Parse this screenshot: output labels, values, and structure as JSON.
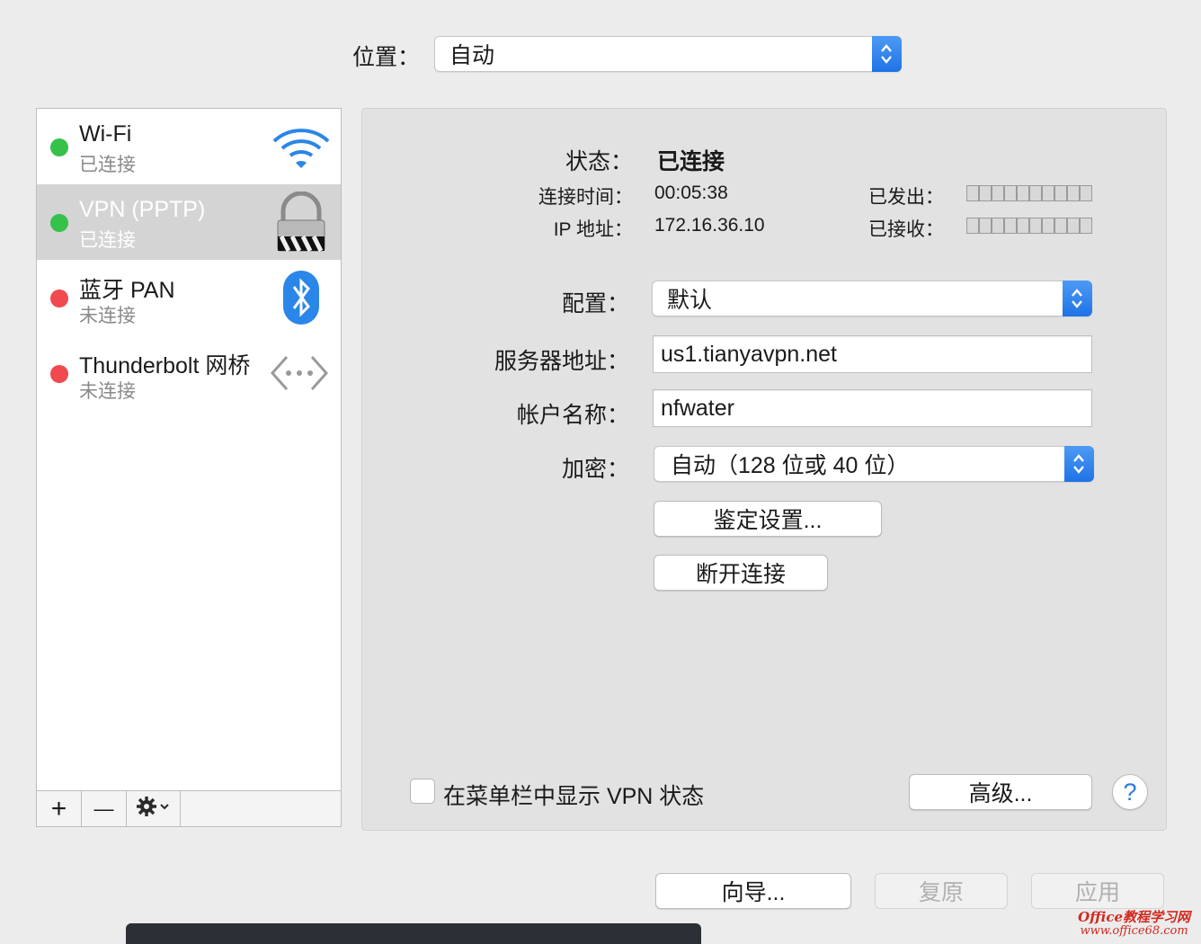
{
  "location": {
    "label": "位置：",
    "value": "自动"
  },
  "sidebar": {
    "services": [
      {
        "name": "Wi-Fi",
        "status": "已连接",
        "dot": "#35c14a",
        "icon": "wifi-icon"
      },
      {
        "name": "VPN (PPTP)",
        "status": "已连接",
        "dot": "#35c14a",
        "icon": "vpn-lock-icon"
      },
      {
        "name": "蓝牙 PAN",
        "status": "未连接",
        "dot": "#f0494f",
        "icon": "bluetooth-icon"
      },
      {
        "name": "Thunderbolt 网桥",
        "status": "未连接",
        "dot": "#f0494f",
        "icon": "thunderbolt-bridge-icon"
      }
    ],
    "toolbar": {
      "add": "+",
      "remove": "—"
    }
  },
  "detail": {
    "status_label": "状态：",
    "status_value": "已连接",
    "conn_time_label": "连接时间：",
    "conn_time_value": "00:05:38",
    "ip_label": "IP 地址：",
    "ip_value": "172.16.36.10",
    "sent_label": "已发出：",
    "received_label": "已接收：",
    "config_label": "配置：",
    "config_value": "默认",
    "server_label": "服务器地址：",
    "server_value": "us1.tianyavpn.net",
    "account_label": "帐户名称：",
    "account_value": "nfwater",
    "encryption_label": "加密：",
    "encryption_value": "自动（128 位或 40 位）",
    "auth_button": "鉴定设置...",
    "disconnect_button": "断开连接",
    "show_vpn_label": "在菜单栏中显示 VPN 状态",
    "advanced_button": "高级...",
    "help": "?"
  },
  "footer": {
    "assist": "向导...",
    "revert": "复原",
    "apply": "应用"
  },
  "watermark": {
    "line1": "Office教程学习网",
    "line2": "www.office68.com"
  },
  "colors": {
    "accent": "#1f73e6",
    "connected": "#35c14a",
    "disconnected": "#f0494f"
  }
}
